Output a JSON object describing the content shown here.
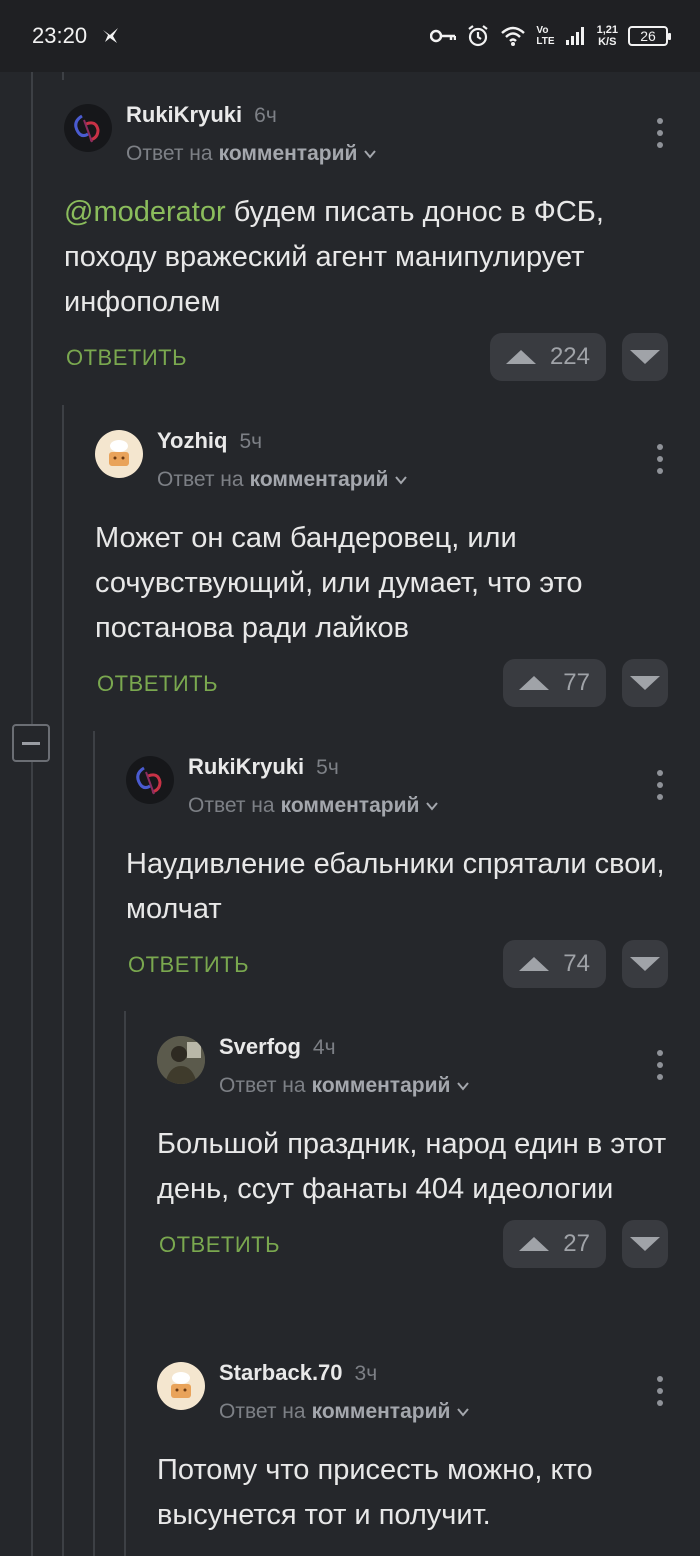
{
  "status_bar": {
    "time": "23:20",
    "net_type_top": "Vo",
    "net_type_bottom": "LTE",
    "speed_value": "1,21",
    "speed_unit": "K/S",
    "battery": "26",
    "icons": [
      "bird-icon",
      "key-icon",
      "alarm-icon",
      "wifi-icon",
      "signal-icon",
      "battery-icon"
    ]
  },
  "reply_prefix": "Ответ на",
  "reply_target": "комментарий",
  "reply_action": "ОТВЕТИТЬ",
  "comments": [
    {
      "user": "RukiKryuki",
      "time": "6ч",
      "mention": "@moderator",
      "text": "будем писать донос в ФСБ, походу вражеский агент манипулирует инфополем",
      "rating": "224"
    },
    {
      "user": "Yozhiq",
      "time": "5ч",
      "text": "Может он сам бандеровец, или сочувствующий, или думает, что это постанова ради лайков",
      "rating": "77"
    },
    {
      "user": "RukiKryuki",
      "time": "5ч",
      "text": "Наудивление ебальники спрятали свои, молчат",
      "rating": "74"
    },
    {
      "user": "Sverfog",
      "time": "4ч",
      "text": "Большой праздник, народ един в этот день, ссут фанаты 404 идеологии",
      "rating": "27"
    },
    {
      "user": "Starback.70",
      "time": "3ч",
      "text": "Потому что присесть можно, кто высунется тот и получит."
    }
  ],
  "colors": {
    "background": "#25272b",
    "accent_green": "#7aa84f",
    "mention_green": "#8bbd5c"
  }
}
